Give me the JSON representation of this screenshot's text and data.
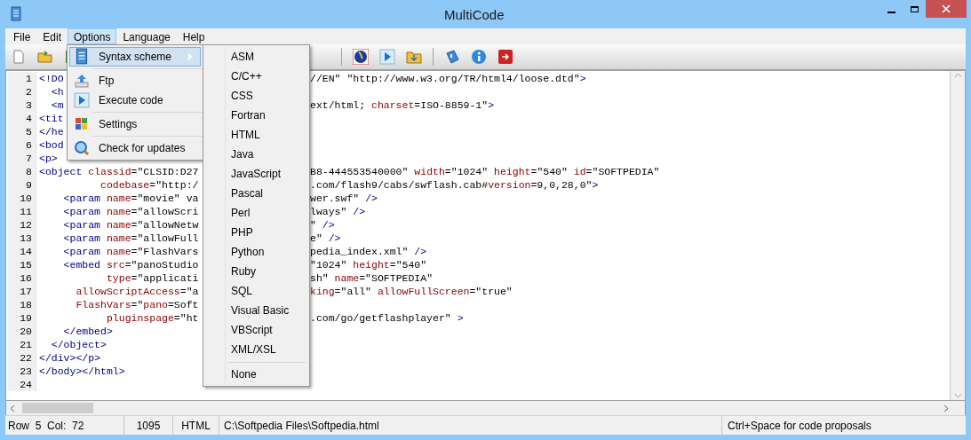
{
  "window": {
    "title": "MultiCode"
  },
  "menu_bar": [
    {
      "label": "File",
      "selected": false
    },
    {
      "label": "Edit",
      "selected": false
    },
    {
      "label": "Options",
      "selected": true
    },
    {
      "label": "Language",
      "selected": false
    },
    {
      "label": "Help",
      "selected": false
    }
  ],
  "options_menu": [
    {
      "kind": "item",
      "label": "Syntax scheme",
      "selected": true,
      "submenu": true
    },
    {
      "kind": "separator"
    },
    {
      "kind": "item",
      "label": "Ftp",
      "selected": false,
      "submenu": false
    },
    {
      "kind": "item",
      "label": "Execute code",
      "selected": false,
      "submenu": false
    },
    {
      "kind": "separator"
    },
    {
      "kind": "item",
      "label": "Settings",
      "selected": false,
      "submenu": false
    },
    {
      "kind": "separator"
    },
    {
      "kind": "item",
      "label": "Check for updates",
      "selected": false,
      "submenu": false
    }
  ],
  "syntax_submenu": [
    {
      "kind": "item",
      "label": "ASM"
    },
    {
      "kind": "item",
      "label": "C/C++"
    },
    {
      "kind": "item",
      "label": "CSS"
    },
    {
      "kind": "item",
      "label": "Fortran"
    },
    {
      "kind": "item",
      "label": "HTML"
    },
    {
      "kind": "item",
      "label": "Java"
    },
    {
      "kind": "item",
      "label": "JavaScript"
    },
    {
      "kind": "item",
      "label": "Pascal"
    },
    {
      "kind": "item",
      "label": "Perl"
    },
    {
      "kind": "item",
      "label": "PHP"
    },
    {
      "kind": "item",
      "label": "Python"
    },
    {
      "kind": "item",
      "label": "Ruby"
    },
    {
      "kind": "item",
      "label": "SQL"
    },
    {
      "kind": "item",
      "label": "Visual Basic"
    },
    {
      "kind": "item",
      "label": "VBScript"
    },
    {
      "kind": "item",
      "label": "XML/XSL"
    },
    {
      "kind": "separator"
    },
    {
      "kind": "item",
      "label": "None"
    }
  ],
  "editor": {
    "lines": [
      {
        "number": "1",
        "left": "<!DO",
        "right": "//EN\" \"http://www.w3.org/TR/html4/loose.dtd\">"
      },
      {
        "number": "2",
        "left": "  <h"
      },
      {
        "number": "3",
        "left": "  <m",
        "right": "ext/html; charset=ISO-8859-1\">"
      },
      {
        "number": "4",
        "left": "<tit"
      },
      {
        "number": "5",
        "left": "</he"
      },
      {
        "number": "6",
        "left": "<bod"
      },
      {
        "number": "7",
        "left": "<p>"
      },
      {
        "number": "8",
        "left": "<object classid=\"CLSID:D27",
        "right": "B8-444553540000\" width=\"1024\" height=\"540\" id=\"SOFTPEDIA\""
      },
      {
        "number": "9",
        "left": "          codebase=\"http:/",
        "right": ".com/flash9/cabs/swflash.cab#version=9,0,28,0\">"
      },
      {
        "number": "10",
        "left": "    <param name=\"movie\" va",
        "right": "wer.swf\" />"
      },
      {
        "number": "11",
        "left": "    <param name=\"allowScri",
        "right": "lways\" />"
      },
      {
        "number": "12",
        "left": "    <param name=\"allowNetw",
        "right": "\" />"
      },
      {
        "number": "13",
        "left": "    <param name=\"allowFull",
        "right": "e\" />"
      },
      {
        "number": "14",
        "left": "    <param name=\"FlashVars",
        "right": "pedia_index.xml\" />"
      },
      {
        "number": "15",
        "left": "    <embed src=\"panoStudio",
        "right": "\"1024\" height=\"540\""
      },
      {
        "number": "16",
        "left": "           type=\"applicati",
        "right": "sh\" name=\"SOFTPEDIA\""
      },
      {
        "number": "17",
        "left": "      allowScriptAccess=\"a",
        "right": "king=\"all\" allowFullScreen=\"true\""
      },
      {
        "number": "18",
        "left": "      FlashVars=\"pano=Soft"
      },
      {
        "number": "19",
        "left": "           pluginspage=\"ht",
        "right": ".com/go/getflashplayer\" >"
      },
      {
        "number": "20",
        "left": "    </embed>"
      },
      {
        "number": "21",
        "left": "  </object>"
      },
      {
        "number": "22",
        "left": "</div></p>"
      },
      {
        "number": "23",
        "left": "</body></html>"
      },
      {
        "number": "24"
      }
    ]
  },
  "status_bar": {
    "position": "Row  5  Col:  72",
    "length": "1095",
    "language": "HTML",
    "file": "C:\\Softpedia Files\\Softpedia.html",
    "hint": "Ctrl+Space for code proposals"
  }
}
